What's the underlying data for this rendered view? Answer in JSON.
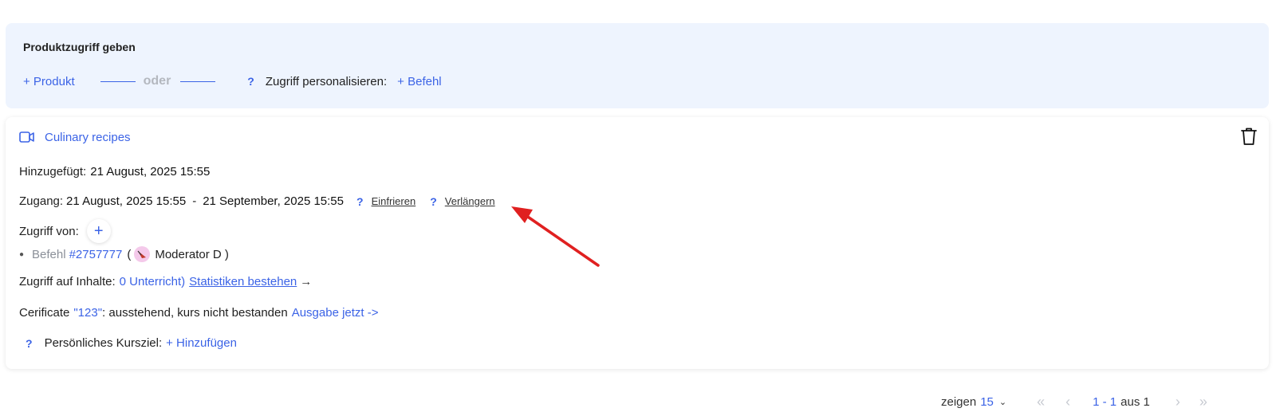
{
  "grant": {
    "title": "Produktzugriff geben",
    "add_product": "+ Produkt",
    "or_label": "oder",
    "help": "?",
    "personalize_label": "Zugriff personalisieren:",
    "add_order": "+ Befehl"
  },
  "card": {
    "product_name": "Culinary recipes",
    "added_label": "Hinzugefügt:",
    "added_value": "21 August, 2025 15:55",
    "access_label": "Zugang:",
    "access_start": "21 August, 2025 15:55",
    "access_dash": "-",
    "access_end": "21 September, 2025 15:55",
    "help": "?",
    "freeze_link": "Einfrieren",
    "extend_link": "Verlängern",
    "access_from_label": "Zugriff von:",
    "add_plus": "+",
    "order_label": "Befehl",
    "order_number": "#2757777",
    "open_paren": "(",
    "moderator": "Moderator D )",
    "content_access_label": "Zugriff auf Inhalte:",
    "lessons_count": "0 Unterricht)",
    "stats_link": "Statistiken bestehen",
    "stats_arrow": "→",
    "certificate_label": "Cerificate",
    "certificate_name": "\"123\"",
    "certificate_status": ": ausstehend, kurs nicht bestanden",
    "issue_link": "Ausgabe jetzt ->",
    "goal_label": "Persönliches Kursziel:",
    "add_goal": "+ Hinzufügen"
  },
  "pagination": {
    "show_label": "zeigen",
    "page_size": "15",
    "range": "1 - 1",
    "of_label": "aus 1",
    "first": "«",
    "prev": "‹",
    "next": "›",
    "last": "»"
  },
  "colors": {
    "accent": "#3b63e6",
    "panel_bg": "#eef4fe",
    "annotation_arrow": "#e02020"
  }
}
